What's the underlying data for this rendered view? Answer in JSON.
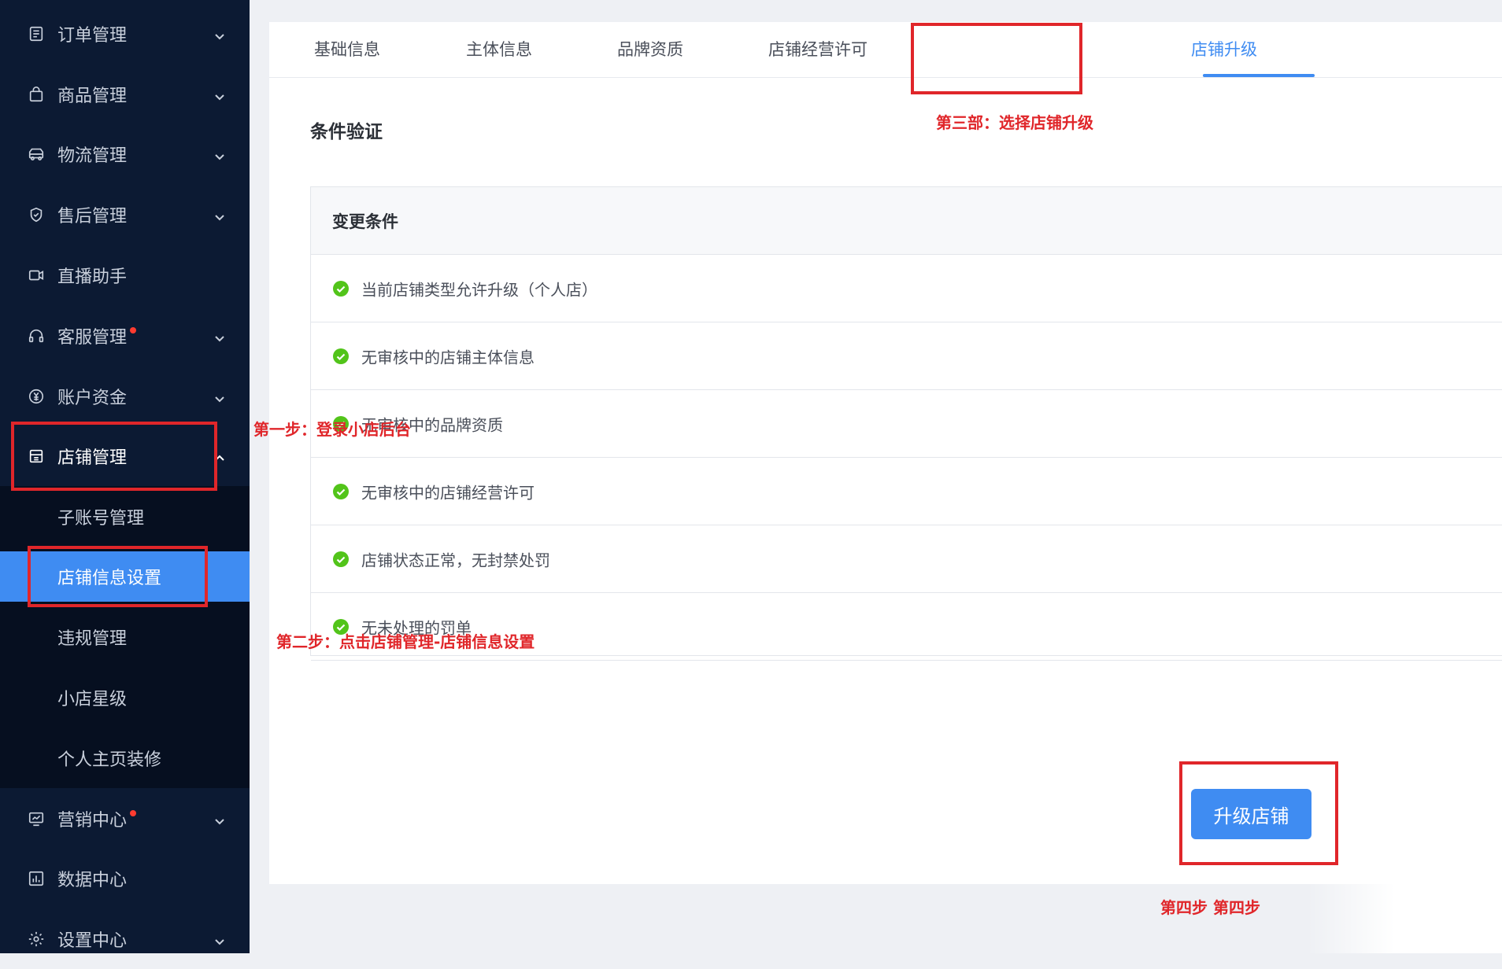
{
  "sidebar": {
    "items": [
      {
        "label": "订单管理",
        "icon": "order-icon"
      },
      {
        "label": "商品管理",
        "icon": "shopping-bag-icon"
      },
      {
        "label": "物流管理",
        "icon": "truck-icon"
      },
      {
        "label": "售后管理",
        "icon": "shield-check-icon"
      },
      {
        "label": "直播助手",
        "icon": "video-camera-icon"
      },
      {
        "label": "客服管理",
        "icon": "headset-icon"
      },
      {
        "label": "账户资金",
        "icon": "yen-coin-icon"
      },
      {
        "label": "店铺管理",
        "icon": "store-icon"
      },
      {
        "label": "营销中心",
        "icon": "chart-board-icon"
      },
      {
        "label": "数据中心",
        "icon": "bar-chart-icon"
      },
      {
        "label": "设置中心",
        "icon": "gear-icon"
      }
    ],
    "submenu": [
      {
        "label": "子账号管理"
      },
      {
        "label": "店铺信息设置"
      },
      {
        "label": "违规管理"
      },
      {
        "label": "小店星级"
      },
      {
        "label": "个人主页装修"
      }
    ]
  },
  "tabs": [
    {
      "label": "基础信息"
    },
    {
      "label": "主体信息"
    },
    {
      "label": "品牌资质"
    },
    {
      "label": "店铺经营许可"
    },
    {
      "label": "店铺升级"
    }
  ],
  "main": {
    "section_title": "条件验证",
    "table_header": "变更条件",
    "conditions": [
      "当前店铺类型允许升级（个人店）",
      "无审核中的店铺主体信息",
      "无审核中的品牌资质",
      "无审核中的店铺经营许可",
      "店铺状态正常，无封禁处罚",
      "无未处理的罚单"
    ],
    "upgrade_button": "升级店铺"
  },
  "annotations": {
    "step1": "第一步：登录小店后台",
    "step2": "第二步：点击店铺管理-店铺信息设置",
    "step3": "第三部：选择店铺升级",
    "step4": "第四步 第四步"
  },
  "colors": {
    "sidebar_bg": "#0c1a33",
    "accent": "#3f8cf2",
    "annotation": "#e0262a",
    "success": "#52c41a"
  }
}
